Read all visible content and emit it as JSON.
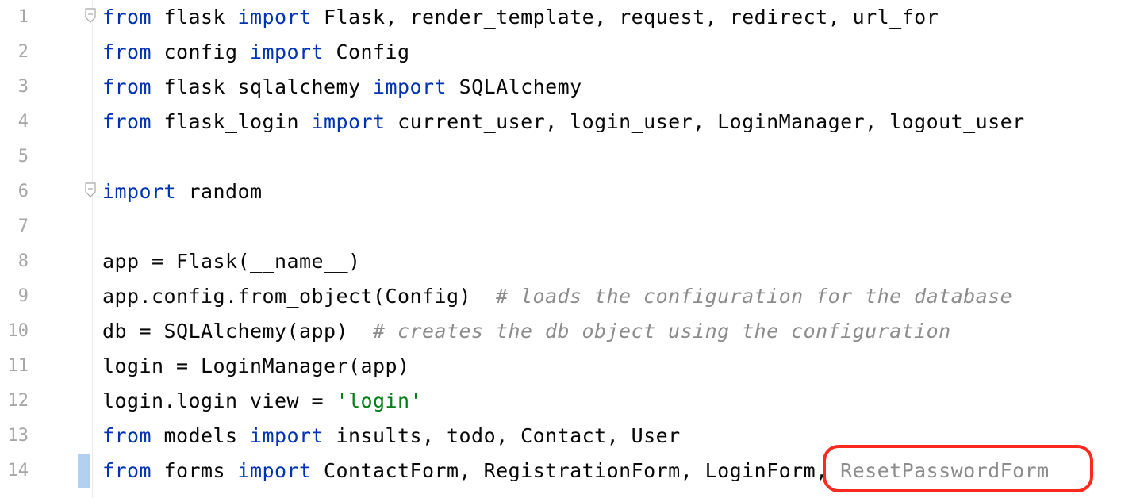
{
  "editor": {
    "language": "python",
    "lines": [
      {
        "number": "1",
        "tokens": [
          {
            "t": "kw",
            "v": "from"
          },
          {
            "t": "plain",
            "v": " flask "
          },
          {
            "t": "kw",
            "v": "import"
          },
          {
            "t": "plain",
            "v": " Flask, render_template, request, redirect, url_for"
          }
        ]
      },
      {
        "number": "2",
        "tokens": [
          {
            "t": "kw",
            "v": "from"
          },
          {
            "t": "plain",
            "v": " config "
          },
          {
            "t": "kw",
            "v": "import"
          },
          {
            "t": "plain",
            "v": " Config"
          }
        ]
      },
      {
        "number": "3",
        "tokens": [
          {
            "t": "kw",
            "v": "from"
          },
          {
            "t": "plain",
            "v": " flask_sqlalchemy "
          },
          {
            "t": "kw",
            "v": "import"
          },
          {
            "t": "plain",
            "v": " SQLAlchemy"
          }
        ]
      },
      {
        "number": "4",
        "tokens": [
          {
            "t": "kw",
            "v": "from"
          },
          {
            "t": "plain",
            "v": " flask_login "
          },
          {
            "t": "kw",
            "v": "import"
          },
          {
            "t": "plain",
            "v": " current_user, login_user, LoginManager, logout_user"
          }
        ]
      },
      {
        "number": "5",
        "tokens": []
      },
      {
        "number": "6",
        "tokens": [
          {
            "t": "kw",
            "v": "import"
          },
          {
            "t": "plain",
            "v": " random"
          }
        ]
      },
      {
        "number": "7",
        "tokens": []
      },
      {
        "number": "8",
        "tokens": [
          {
            "t": "plain",
            "v": "app = Flask(__name__)"
          }
        ]
      },
      {
        "number": "9",
        "tokens": [
          {
            "t": "plain",
            "v": "app.config.from_object(Config)  "
          },
          {
            "t": "cmt",
            "v": "# loads the configuration for the database"
          }
        ]
      },
      {
        "number": "10",
        "tokens": [
          {
            "t": "plain",
            "v": "db = SQLAlchemy(app)  "
          },
          {
            "t": "cmt",
            "v": "# creates the db object using the configuration"
          }
        ]
      },
      {
        "number": "11",
        "tokens": [
          {
            "t": "plain",
            "v": "login = LoginManager(app)"
          }
        ]
      },
      {
        "number": "12",
        "tokens": [
          {
            "t": "plain",
            "v": "login.login_view = "
          },
          {
            "t": "str",
            "v": "'login'"
          }
        ]
      },
      {
        "number": "13",
        "tokens": [
          {
            "t": "kw",
            "v": "from"
          },
          {
            "t": "plain",
            "v": " models "
          },
          {
            "t": "kw",
            "v": "import"
          },
          {
            "t": "plain",
            "v": " insults, todo, Contact, User"
          }
        ]
      },
      {
        "number": "14",
        "tokens": [
          {
            "t": "kw",
            "v": "from"
          },
          {
            "t": "plain",
            "v": " forms "
          },
          {
            "t": "kw",
            "v": "import"
          },
          {
            "t": "plain",
            "v": " ContactForm, RegistrationForm, LoginForm, "
          },
          {
            "t": "dim",
            "v": "ResetPasswordForm"
          }
        ]
      }
    ],
    "fold_markers_on_lines": [
      "1",
      "6"
    ],
    "current_line": "14",
    "highlight_annotation": "ResetPasswordForm"
  },
  "colors": {
    "keyword": "#0033b3",
    "comment": "#8c8c8c",
    "string": "#067d17",
    "unused_import": "#8c8c8c",
    "annotation": "#ff2a1f",
    "line_number": "#a6a6a6"
  }
}
